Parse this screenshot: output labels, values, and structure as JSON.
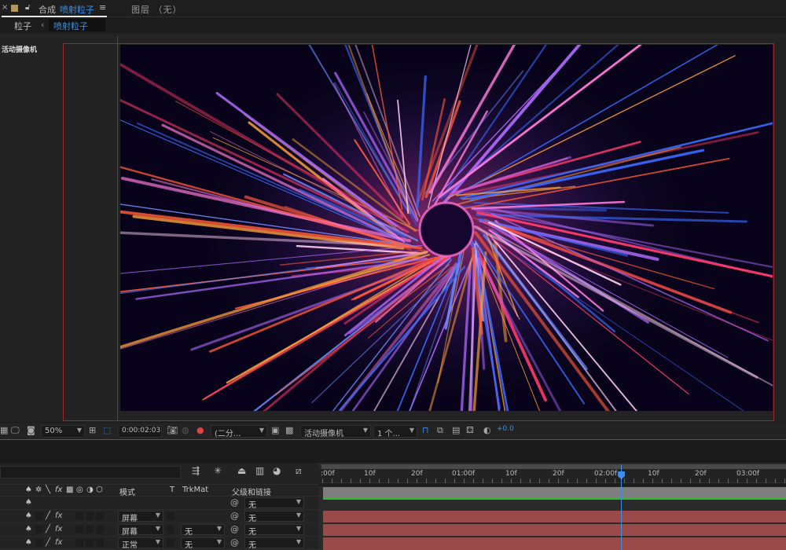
{
  "tabs": {
    "close_glyph": "×",
    "comp_prefix": "合成",
    "comp_name": "喷射粒子",
    "menu_glyph": "≡",
    "layer_tab": "图层 （无）"
  },
  "breadcrumb": {
    "parent": "粒子",
    "arrow": "‹",
    "active": "喷射粒子"
  },
  "viewer": {
    "camera_label": "活动摄像机"
  },
  "toolbar": {
    "zoom": "50%",
    "timecode": "0:00:02:03",
    "resolution": "(二分...",
    "camera": "活动摄像机",
    "views": "1 个...",
    "exposure": "+0.0"
  },
  "timeline": {
    "headers": {
      "mode": "模式",
      "t": "T",
      "trkmat": "TrkMat",
      "parent": "父级和链接"
    },
    "rows": [
      {
        "mode": "",
        "trkmat": "",
        "parent": "无"
      },
      {
        "mode": "屏幕",
        "trkmat": "",
        "parent": "无"
      },
      {
        "mode": "屏幕",
        "trkmat": "无",
        "parent": "无"
      },
      {
        "mode": "正常",
        "trkmat": "无",
        "parent": "无"
      }
    ],
    "ruler_labels": [
      ":00f",
      "10f",
      "20f",
      "01:00f",
      "10f",
      "20f",
      "02:00f",
      "10f",
      "20f",
      "03:00f"
    ],
    "current_time": "0:00:02:03"
  },
  "colors": {
    "accent": "#3c8fe6",
    "frame": "#9a2a2a",
    "layer_bar": "#9b4a4a",
    "adjust_bar": "#7f7f7f"
  }
}
